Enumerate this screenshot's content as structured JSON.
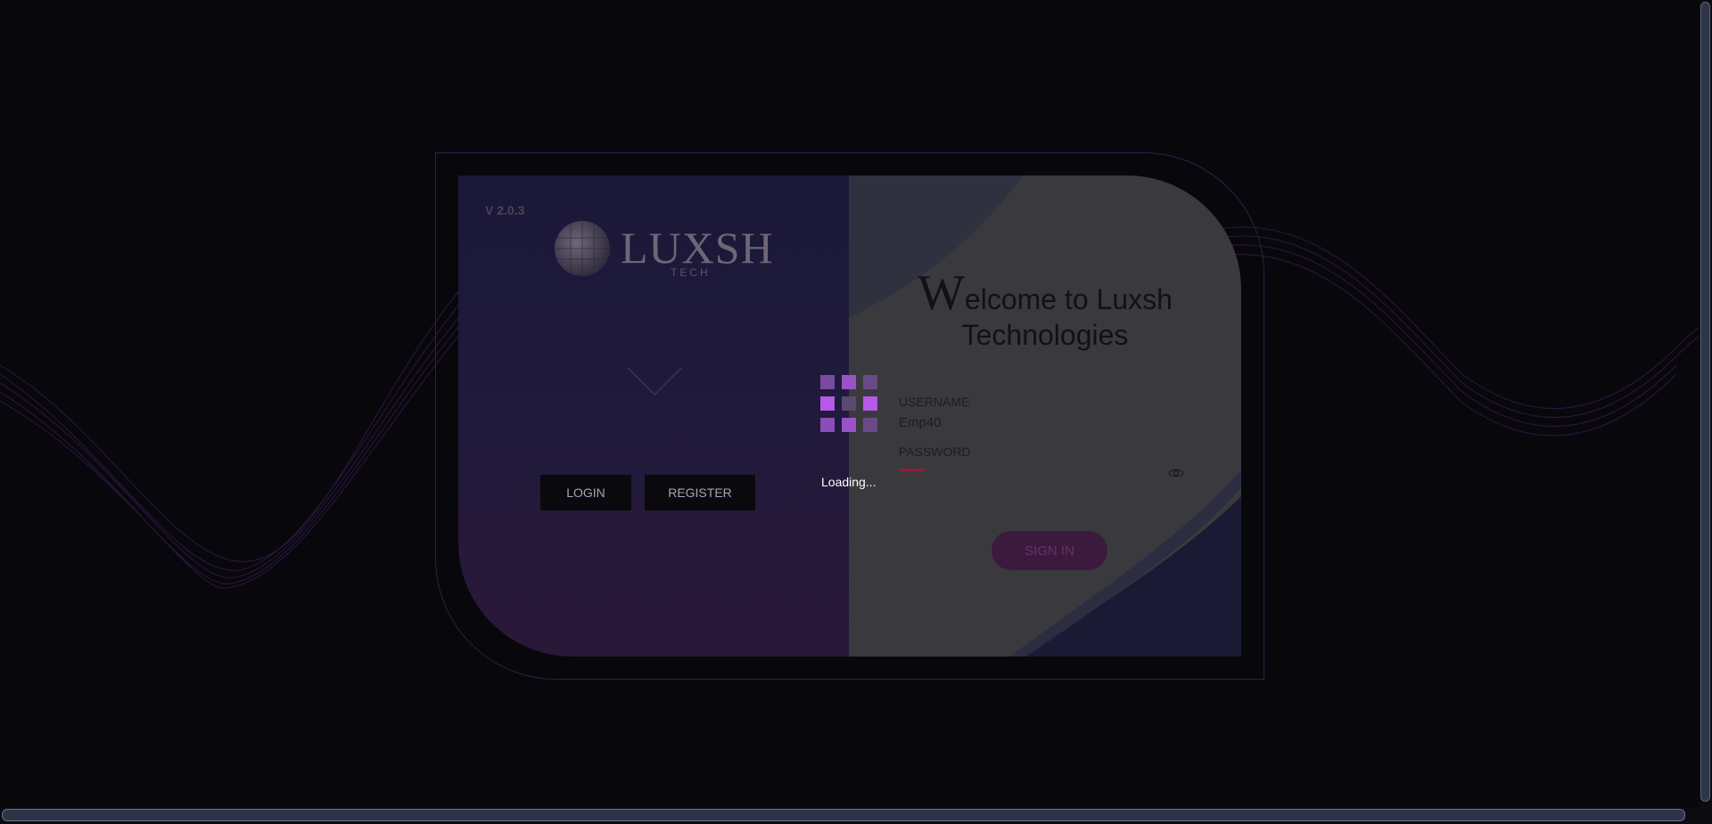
{
  "version": "V 2.0.3",
  "logo": {
    "word": "LUXSH",
    "sub": "TECH"
  },
  "buttons": {
    "login": "LOGIN",
    "register": "REGISTER",
    "signin": "SIGN IN"
  },
  "welcome": {
    "first_letter": "W",
    "rest_line1": "elcome to Luxsh",
    "line2": "Technologies"
  },
  "form": {
    "username_label": "USERNAME",
    "username_value": "Emp40",
    "password_label": "PASSWORD",
    "password_mask": "••••••••"
  },
  "loader": {
    "text": "Loading..."
  },
  "colors": {
    "accent": "#b45ae6",
    "loader_dim": "#7a4aa0",
    "signin_bg": "#3c1a3e"
  },
  "icons": [
    "globe-logo-icon",
    "chevron-down-icon",
    "eye-icon"
  ]
}
